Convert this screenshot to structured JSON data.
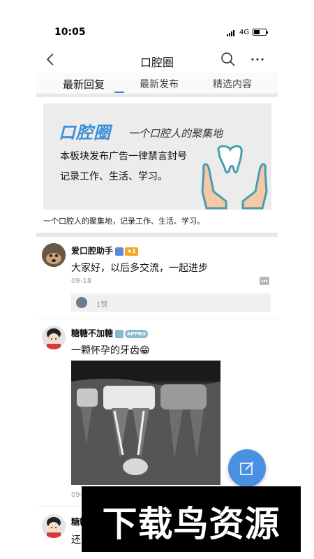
{
  "status_bar": {
    "time": "10:05",
    "network": "4G"
  },
  "navbar": {
    "title": "口腔圈"
  },
  "tabs": [
    {
      "label": "最新回复",
      "active": true
    },
    {
      "label": "最新发布",
      "active": false
    },
    {
      "label": "精选内容",
      "active": false
    }
  ],
  "banner": {
    "logo": "口腔圈",
    "slogan": "一个口腔人的聚集地",
    "line1": "本板块发布广告一律禁言封号",
    "line2": "记录工作、生活、学习。"
  },
  "circle_description": "一个口腔人的聚集地，记录工作、生活、学习。",
  "posts": [
    {
      "username": "爱口腔助手",
      "star_badge": "★1",
      "content": "大家好，以后多交流，一起进步",
      "date": "09-18",
      "likes": "1赞"
    },
    {
      "username": "糖糖不加糖",
      "app_badge": "APPRO",
      "content": "一颗怀孕的牙齿😁",
      "date": "09-",
      "image": "dental-xray"
    },
    {
      "username": "糖糖",
      "content": "还"
    }
  ],
  "watermark": "下载鸟资源",
  "colors": {
    "accent": "#3a7bd5",
    "fab": "#4a90e2",
    "banner_bg": "#ececec"
  }
}
